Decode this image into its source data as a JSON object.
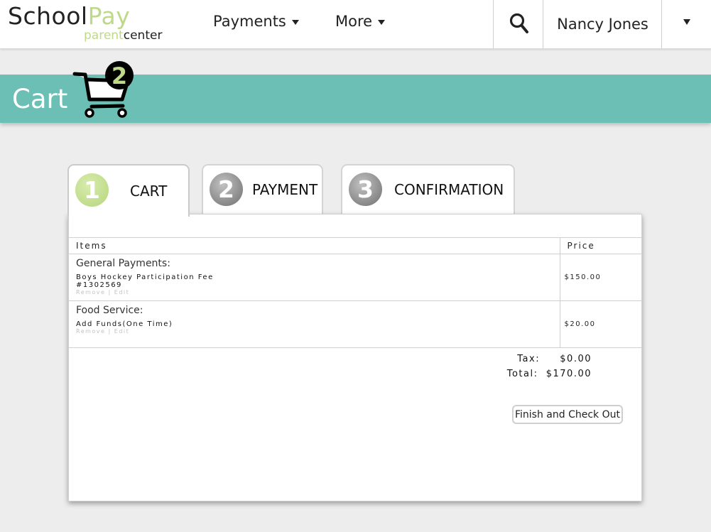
{
  "header": {
    "logo": {
      "school": "School",
      "pay": "Pay",
      "parent": "parent",
      "center": "center"
    },
    "nav": [
      {
        "label": "Payments"
      },
      {
        "label": "More"
      }
    ],
    "user_name": "Nancy Jones"
  },
  "banner": {
    "title": "Cart",
    "cart_count": "2"
  },
  "tabs": [
    {
      "number": "1",
      "label": "CART"
    },
    {
      "number": "2",
      "label": "PAYMENT"
    },
    {
      "number": "3",
      "label": "CONFIRMATION"
    }
  ],
  "table": {
    "headers": {
      "items": "Items",
      "price": "Price"
    },
    "rows": [
      {
        "category": "General Payments:",
        "description": "Boys Hockey Participation Fee",
        "reference": "#1302569",
        "remove": "Remove",
        "separator": "|",
        "edit": "Edit",
        "price": "$150.00"
      },
      {
        "category": "Food Service:",
        "description": "Add Funds(One Time)",
        "remove": "Remove",
        "separator": "|",
        "edit": "Edit",
        "price": "$20.00"
      }
    ]
  },
  "totals": {
    "tax_label": "Tax:",
    "tax_value": "$0.00",
    "total_label": "Total:",
    "total_value": "$170.00"
  },
  "actions": {
    "checkout_label": "Finish and Check Out"
  },
  "colors": {
    "brand_green": "#bfd98a",
    "banner_teal": "#6bbfb5"
  }
}
